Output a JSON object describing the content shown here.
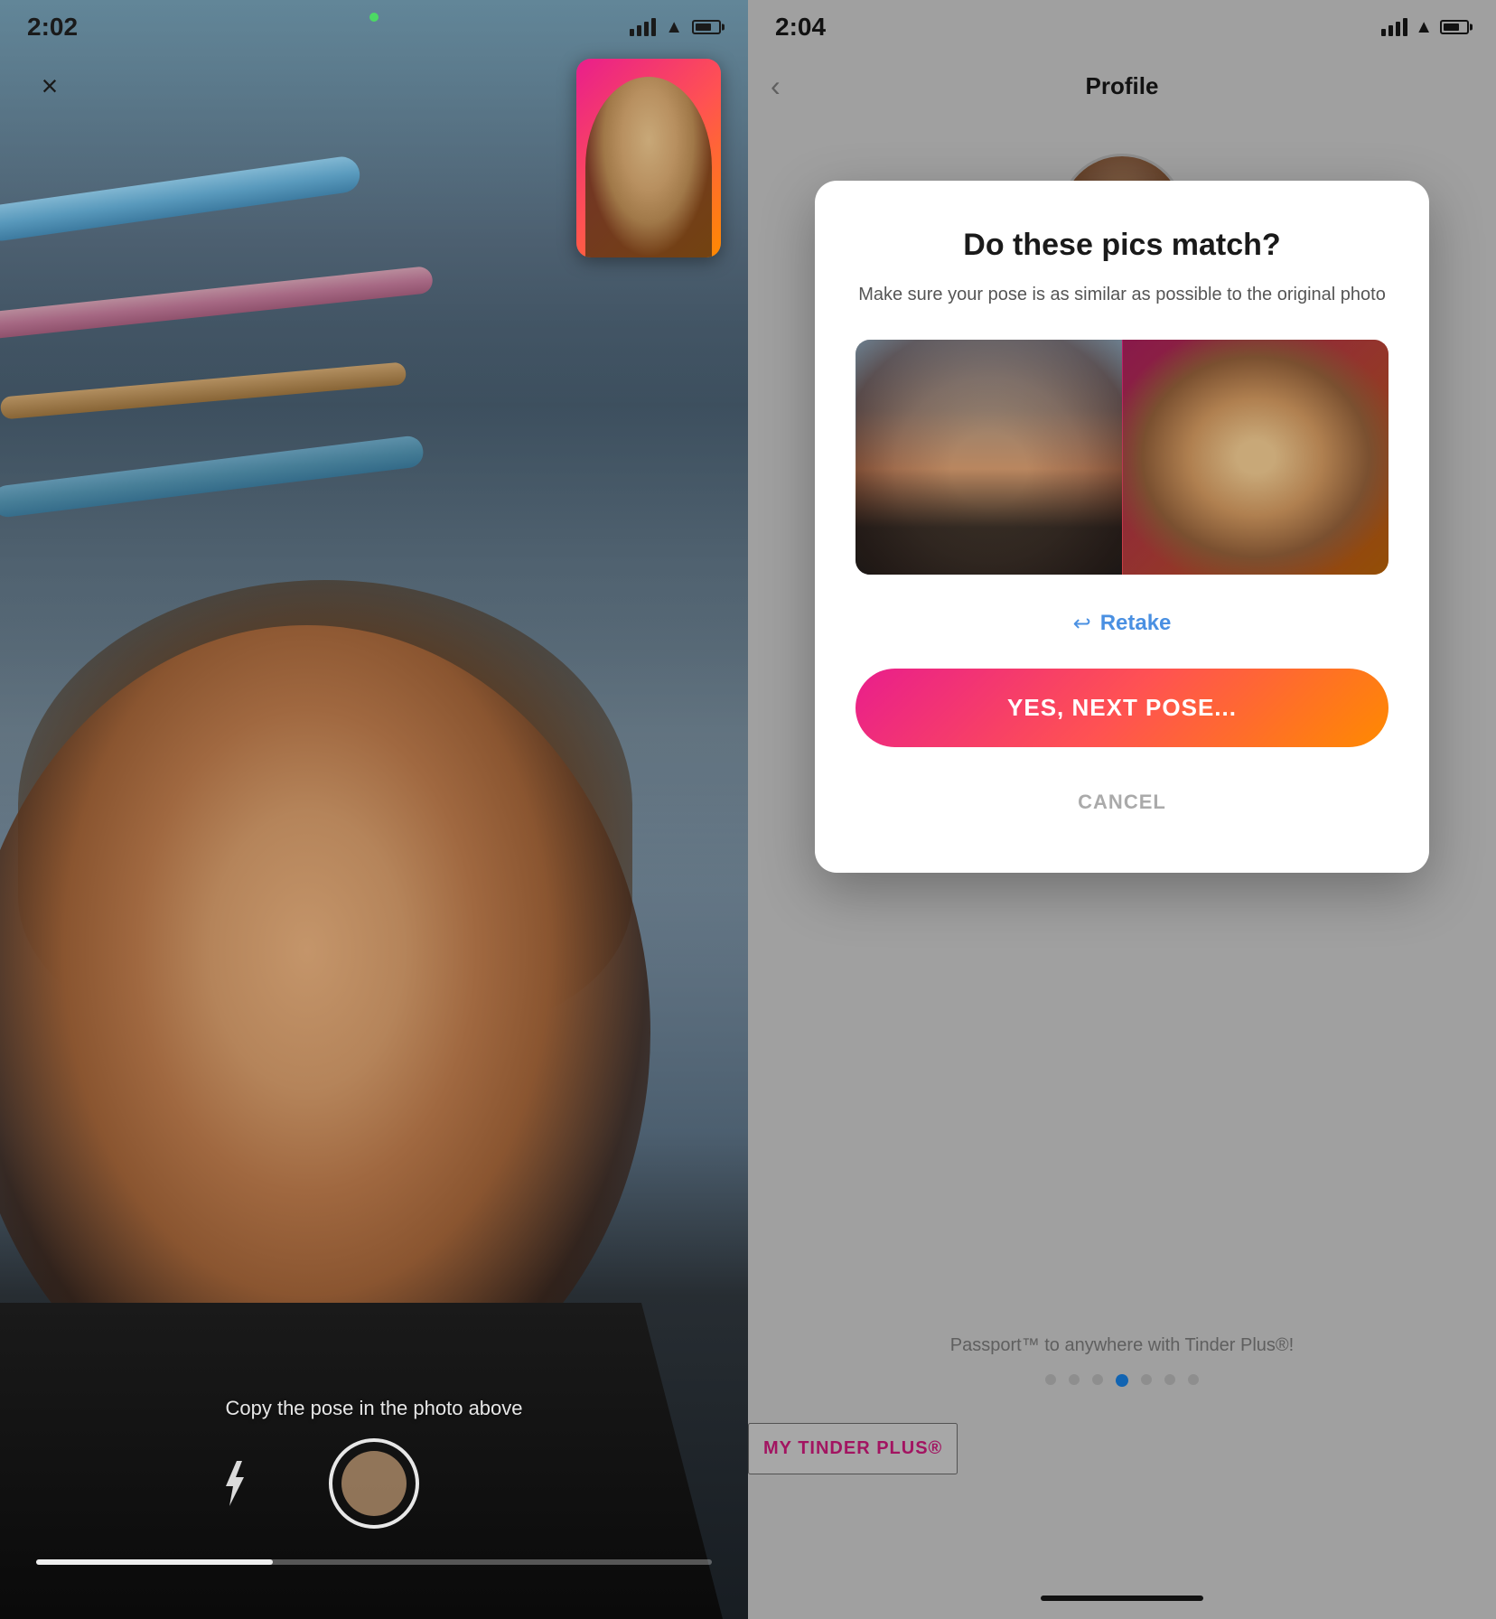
{
  "left": {
    "time": "2:02",
    "time_icon": "navigation-icon",
    "close_label": "×",
    "copy_pose_text": "Copy the pose in the photo above",
    "progress": 35
  },
  "right": {
    "time": "2:04",
    "time_icon": "navigation-icon",
    "back_label": "‹",
    "page_title": "Profile",
    "modal": {
      "title": "Do these pics match?",
      "subtitle": "Make sure your pose is as similar as possible to the original photo",
      "retake_label": "Retake",
      "yes_button_label": "YES, NEXT POSE...",
      "cancel_label": "CANCEL"
    },
    "bottom": {
      "passport_text": "Passport™ to anywhere with Tinder Plus®!",
      "tinder_plus_label": "MY TINDER PLUS®"
    }
  }
}
